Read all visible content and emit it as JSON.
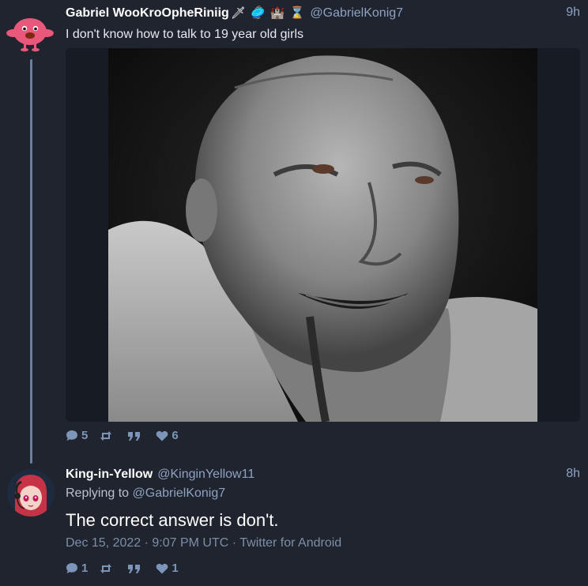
{
  "post1": {
    "display_name": "Gabriel WooKroOpheRiniig",
    "emoji_badges": "🗡 🥏 🏰 ⌛",
    "handle": "@GabrielKonig7",
    "time_ago": "9h",
    "text": "I don't know how to talk to 19 year old girls",
    "stats": {
      "replies": "5",
      "retweets": "",
      "quotes": "",
      "likes": "6"
    }
  },
  "post2": {
    "display_name": "King-in-Yellow",
    "handle": "@KinginYellow11",
    "time_ago": "8h",
    "replying_prefix": "Replying to",
    "replying_to": "@GabrielKonig7",
    "text": "The correct answer is don't.",
    "meta": "Dec 15, 2022 · 9:07 PM UTC · Twitter for Android",
    "stats": {
      "replies": "1",
      "retweets": "",
      "quotes": "",
      "likes": "1"
    }
  },
  "colors": {
    "background": "#20242e",
    "accent": "#8da2c2",
    "icon": "#7c95b8",
    "thread_line": "#6a7f9f"
  },
  "icons": [
    "comment-icon",
    "retweet-icon",
    "quote-icon",
    "heart-icon"
  ]
}
